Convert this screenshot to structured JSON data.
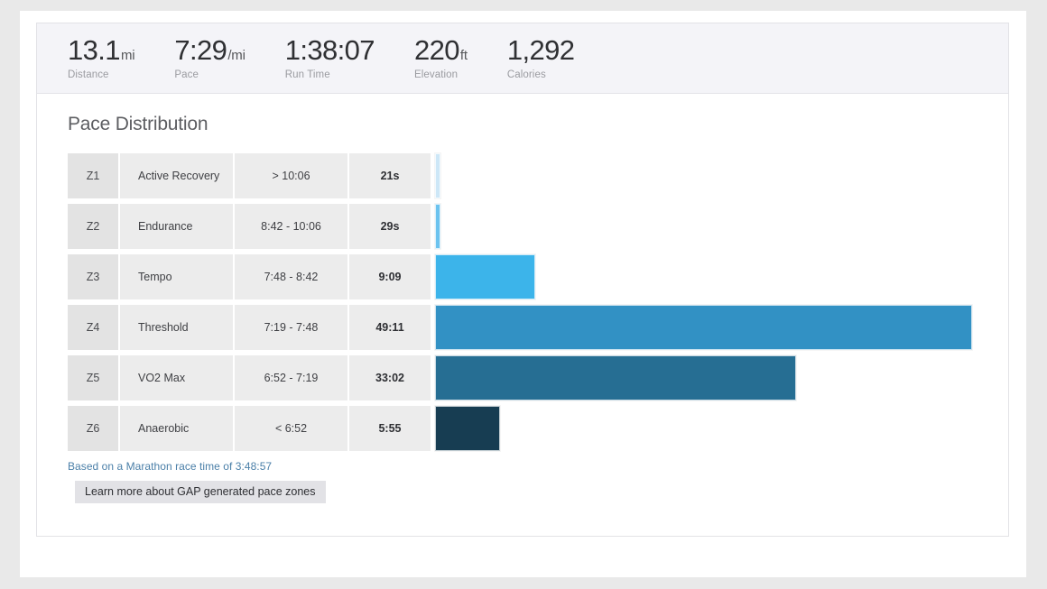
{
  "stats": [
    {
      "value": "13.1",
      "unit": "mi",
      "label": "Distance"
    },
    {
      "value": "7:29",
      "unit": "/mi",
      "label": "Pace"
    },
    {
      "value": "1:38:07",
      "unit": "",
      "label": "Run Time"
    },
    {
      "value": "220",
      "unit": "ft",
      "label": "Elevation"
    },
    {
      "value": "1,292",
      "unit": "",
      "label": "Calories"
    }
  ],
  "section": {
    "title": "Pace Distribution",
    "footnote": "Based on a Marathon race time of 3:48:57",
    "learn_more_label": "Learn more about GAP generated pace zones"
  },
  "chart_data": {
    "type": "bar",
    "title": "Pace Distribution",
    "xlabel": "",
    "ylabel": "",
    "orientation": "horizontal",
    "categories": [
      "Z1",
      "Z2",
      "Z3",
      "Z4",
      "Z5",
      "Z6"
    ],
    "zone_names": [
      "Active Recovery",
      "Endurance",
      "Tempo",
      "Threshold",
      "VO2 Max",
      "Anaerobic"
    ],
    "pace_ranges": [
      "> 10:06",
      "8:42 - 10:06",
      "7:48 - 8:42",
      "7:19 - 7:48",
      "6:52 - 7:19",
      "< 6:52"
    ],
    "time_labels": [
      "21s",
      "29s",
      "9:09",
      "49:11",
      "33:02",
      "5:55"
    ],
    "values_seconds": [
      21,
      29,
      549,
      2951,
      1982,
      355
    ],
    "max_value_seconds": 2951,
    "colors": [
      "#cde7f7",
      "#6cc3ef",
      "#3cb4ea",
      "#3291c4",
      "#266e93",
      "#173d52"
    ]
  },
  "zones": [
    {
      "zone": "Z1",
      "name": "Active Recovery",
      "range": "> 10:06",
      "time": "21s",
      "seconds": 21,
      "color": "#cde7f7"
    },
    {
      "zone": "Z2",
      "name": "Endurance",
      "range": "8:42 - 10:06",
      "time": "29s",
      "seconds": 29,
      "color": "#6cc3ef"
    },
    {
      "zone": "Z3",
      "name": "Tempo",
      "range": "7:48 - 8:42",
      "time": "9:09",
      "seconds": 549,
      "color": "#3cb4ea"
    },
    {
      "zone": "Z4",
      "name": "Threshold",
      "range": "7:19 - 7:48",
      "time": "49:11",
      "seconds": 2951,
      "color": "#3291c4"
    },
    {
      "zone": "Z5",
      "name": "VO2 Max",
      "range": "6:52 - 7:19",
      "time": "33:02",
      "seconds": 1982,
      "color": "#266e93"
    },
    {
      "zone": "Z6",
      "name": "Anaerobic",
      "range": "< 6:52",
      "time": "5:55",
      "seconds": 355,
      "color": "#173d52"
    }
  ]
}
